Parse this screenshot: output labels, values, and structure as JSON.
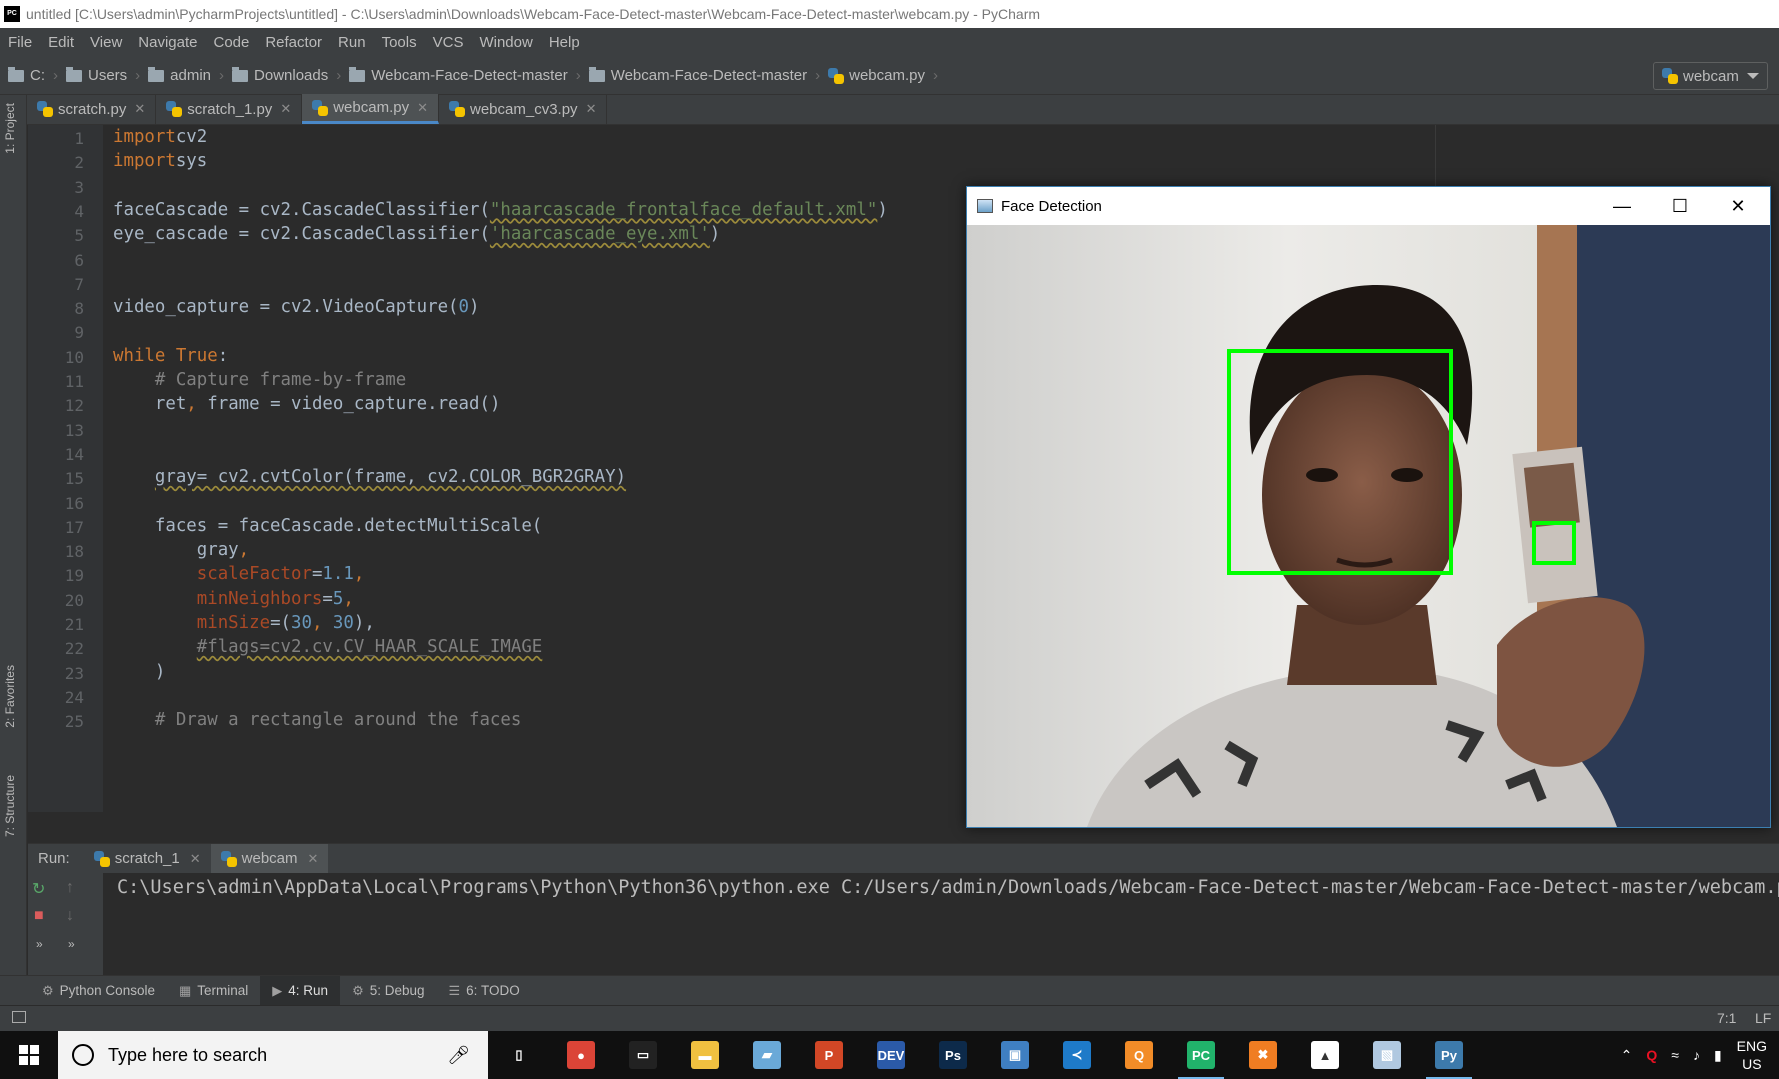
{
  "window": {
    "title": "untitled [C:\\Users\\admin\\PycharmProjects\\untitled] - C:\\Users\\admin\\Downloads\\Webcam-Face-Detect-master\\Webcam-Face-Detect-master\\webcam.py - PyCharm"
  },
  "menu": [
    "File",
    "Edit",
    "View",
    "Navigate",
    "Code",
    "Refactor",
    "Run",
    "Tools",
    "VCS",
    "Window",
    "Help"
  ],
  "breadcrumbs": [
    "C:",
    "Users",
    "admin",
    "Downloads",
    "Webcam-Face-Detect-master",
    "Webcam-Face-Detect-master",
    "webcam.py"
  ],
  "run_config": {
    "label": "webcam"
  },
  "side_tabs": {
    "project": "1: Project",
    "favorites": "2: Favorites",
    "structure": "7: Structure"
  },
  "editor_tabs": [
    {
      "label": "scratch.py",
      "active": false
    },
    {
      "label": "scratch_1.py",
      "active": false
    },
    {
      "label": "webcam.py",
      "active": true
    },
    {
      "label": "webcam_cv3.py",
      "active": false
    }
  ],
  "editor": {
    "cursor_line": 7,
    "lines": [
      {
        "n": "1",
        "code": [
          [
            "kw",
            "import"
          ],
          [
            "",
            "cv2"
          ]
        ]
      },
      {
        "n": "2",
        "code": [
          [
            "kw",
            "import"
          ],
          [
            "",
            "sys"
          ]
        ]
      },
      {
        "n": "3",
        "code": []
      },
      {
        "n": "4",
        "code": [
          [
            "",
            "faceCascade = cv2.CascadeClassifier("
          ],
          [
            "str under",
            "\"haarcascade_frontalface_default.xml\""
          ],
          [
            "",
            ")"
          ]
        ]
      },
      {
        "n": "5",
        "code": [
          [
            "",
            "eye_cascade = cv2.CascadeClassifier("
          ],
          [
            "str under",
            "'haarcascade_eye.xml'"
          ],
          [
            "",
            ")"
          ]
        ]
      },
      {
        "n": "6",
        "code": []
      },
      {
        "n": "7",
        "code": []
      },
      {
        "n": "8",
        "code": [
          [
            "",
            "video_capture = cv2.VideoCapture("
          ],
          [
            "num",
            "0"
          ],
          [
            "",
            ")"
          ]
        ]
      },
      {
        "n": "9",
        "code": []
      },
      {
        "n": "10",
        "code": [
          [
            "kw",
            "while"
          ],
          [
            "kw",
            " True"
          ],
          [
            "",
            ":"
          ]
        ]
      },
      {
        "n": "11",
        "code": [
          [
            "cmt",
            "    # Capture frame-by-frame"
          ]
        ]
      },
      {
        "n": "12",
        "code": [
          [
            "",
            "    ret"
          ],
          [
            "kw",
            ", "
          ],
          [
            "",
            "frame = video_capture.read()"
          ]
        ]
      },
      {
        "n": "13",
        "code": []
      },
      {
        "n": "14",
        "code": []
      },
      {
        "n": "15",
        "code": [
          [
            "",
            "    "
          ],
          [
            "under",
            "gray= cv2.cvtColor(frame, cv2.COLOR_BGR2GRAY)"
          ]
        ]
      },
      {
        "n": "16",
        "code": []
      },
      {
        "n": "17",
        "code": [
          [
            "",
            "    faces = faceCascade.detectMultiScale("
          ]
        ]
      },
      {
        "n": "18",
        "code": [
          [
            "",
            "        gray"
          ],
          [
            "kw",
            ","
          ]
        ]
      },
      {
        "n": "19",
        "code": [
          [
            "param",
            "        scaleFactor"
          ],
          [
            "",
            "="
          ],
          [
            "num",
            "1.1"
          ],
          [
            "kw",
            ","
          ]
        ]
      },
      {
        "n": "20",
        "code": [
          [
            "param",
            "        minNeighbors"
          ],
          [
            "",
            "="
          ],
          [
            "num",
            "5"
          ],
          [
            "kw",
            ","
          ]
        ]
      },
      {
        "n": "21",
        "code": [
          [
            "param",
            "        minSize"
          ],
          [
            "",
            "=("
          ],
          [
            "num",
            "30"
          ],
          [
            "kw",
            ", "
          ],
          [
            "num",
            "30"
          ],
          [
            "",
            "),"
          ]
        ]
      },
      {
        "n": "22",
        "code": [
          [
            "",
            "        "
          ],
          [
            "cmt under",
            "#flags=cv2.cv.CV_HAAR_SCALE_IMAGE"
          ]
        ]
      },
      {
        "n": "23",
        "code": [
          [
            "",
            "    )"
          ]
        ]
      },
      {
        "n": "24",
        "code": []
      },
      {
        "n": "25",
        "code": [
          [
            "cmt",
            "    # Draw a rectangle around the faces"
          ]
        ]
      }
    ]
  },
  "face_window": {
    "title": "Face Detection",
    "detections": [
      {
        "label": "face",
        "color": "#00ff00"
      },
      {
        "label": "face",
        "color": "#00ff00"
      }
    ]
  },
  "run_panel": {
    "label": "Run:",
    "tabs": [
      {
        "label": "scratch_1",
        "active": false
      },
      {
        "label": "webcam",
        "active": true
      }
    ],
    "output": "C:\\Users\\admin\\AppData\\Local\\Programs\\Python\\Python36\\python.exe C:/Users/admin/Downloads/Webcam-Face-Detect-master/Webcam-Face-Detect-master/webcam.py"
  },
  "tool_windows": [
    {
      "label": "Python Console",
      "active": false
    },
    {
      "label": "Terminal",
      "active": false
    },
    {
      "label": "4: Run",
      "active": true
    },
    {
      "label": "5: Debug",
      "active": false
    },
    {
      "label": "6: TODO",
      "active": false
    }
  ],
  "status": {
    "position": "7:1",
    "line_sep": "LF"
  },
  "taskbar": {
    "search_placeholder": "Type here to search",
    "apps": [
      {
        "name": "task-view-icon",
        "color": "#101010",
        "glyph": "▯",
        "running": false
      },
      {
        "name": "chrome-icon",
        "color": "#db4437",
        "glyph": "●",
        "running": false
      },
      {
        "name": "cmd-icon",
        "color": "#222222",
        "glyph": "▭",
        "running": false
      },
      {
        "name": "explorer-icon",
        "color": "#f0c040",
        "glyph": "▬",
        "running": false
      },
      {
        "name": "notepad-icon",
        "color": "#6aa9d8",
        "glyph": "▰",
        "running": false
      },
      {
        "name": "powerpoint-icon",
        "color": "#d24726",
        "glyph": "P",
        "running": false
      },
      {
        "name": "devcpp-icon",
        "color": "#2b5aa8",
        "glyph": "DEV",
        "running": false
      },
      {
        "name": "photoshop-icon",
        "color": "#0d2a4a",
        "glyph": "Ps",
        "running": false
      },
      {
        "name": "remote-icon",
        "color": "#3f7fc2",
        "glyph": "▣",
        "running": false
      },
      {
        "name": "vscode-icon",
        "color": "#1e7ac8",
        "glyph": "≺",
        "running": false
      },
      {
        "name": "qt-icon",
        "color": "#f28c28",
        "glyph": "Q",
        "running": false
      },
      {
        "name": "pycharm-icon",
        "color": "#21b36b",
        "glyph": "PC",
        "running": true
      },
      {
        "name": "xampp-icon",
        "color": "#f07d22",
        "glyph": "✖",
        "running": false
      },
      {
        "name": "photos-icon",
        "color": "#ffffff",
        "glyph": "▲",
        "running": false
      },
      {
        "name": "image-icon",
        "color": "#b0c8e0",
        "glyph": "▧",
        "running": false
      },
      {
        "name": "python-icon",
        "color": "#3d7aab",
        "glyph": "Py",
        "running": true
      }
    ],
    "tray": {
      "lang_top": "ENG",
      "lang_bottom": "US"
    }
  }
}
